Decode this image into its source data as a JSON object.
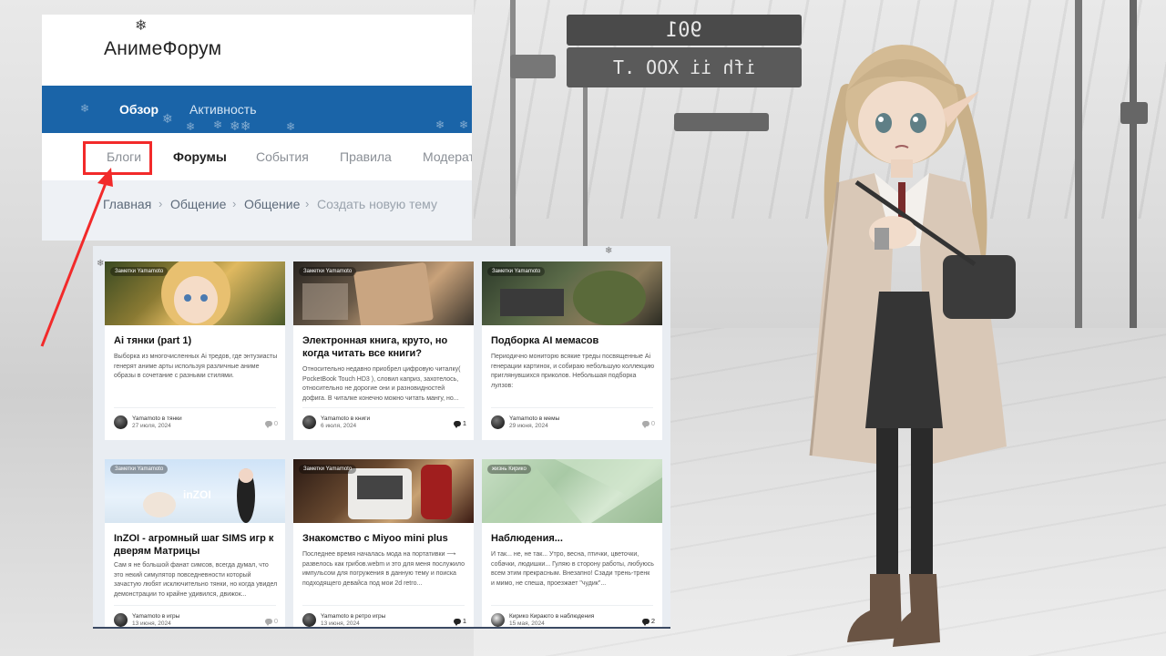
{
  "site": {
    "title": "АнимеФорум"
  },
  "nav": {
    "items": [
      {
        "label": "Обзор",
        "active": true
      },
      {
        "label": "Активность",
        "active": false
      }
    ]
  },
  "subnav": {
    "items": [
      "Блоги",
      "Форумы",
      "События",
      "Правила",
      "Модерат"
    ]
  },
  "breadcrumb": {
    "items": [
      "Главная",
      "Общение",
      "Общение",
      "Создать новую тему"
    ]
  },
  "background": {
    "sign_top": "901",
    "sign_bottom": "ifh ii XOO .T"
  },
  "colors": {
    "nav": "#1a64a8",
    "highlight": "#f22a2a",
    "panel_bg": "#e9edf2"
  },
  "cards": [
    {
      "category": "Заметки Yamamoto",
      "title": "Ai тянки (part 1)",
      "excerpt": "Выборка из многочисленных Ai тредов, где энтузиасты генерят аниме арты используя различные аниме образы в сочетание с разными стилями.",
      "author": "Yamamoto в тянки",
      "date": "27 июля, 2024",
      "comments": "0"
    },
    {
      "category": "Заметки Yamamoto",
      "title": "Электронная книга, круто, но когда читать все книги?",
      "excerpt": "Относительно недавно приобрел цифровую читалку( PocketBook Touch HD3 ), словил каприз, захотелось, относительно не дорогие они и разновидностей дофига. В читалке конечно можно читать мангу, но...",
      "author": "Yamamoto в книги",
      "date": "6 июля, 2024",
      "comments": "1"
    },
    {
      "category": "Заметки Yamamoto",
      "title": "Подборка AI мемасов",
      "excerpt": "Периодично мониторю всякие треды посвященные Ai генерации картинок, и собираю небольшую коллекцию приглянувшихся приколов. Небольшая подборка лулзов:",
      "author": "Yamamoto в мемы",
      "date": "29 июня, 2024",
      "comments": "0"
    },
    {
      "category": "Заметки Yamamoto",
      "title": "InZOI - агромный шаг SIMS игр к дверям Матрицы",
      "excerpt": "Сам я не большой фанат симсов, всегда думал, что это некий симулятор повседневности который зачастую любят исключительно тянки, но когда увидел демонстрации то крайне удивился, движок...",
      "author": "Yamamoto в игры",
      "date": "13 июня, 2024",
      "comments": "0"
    },
    {
      "category": "Заметки Yamamoto",
      "title": "Знакомство с Miyoo mini plus",
      "excerpt": "Последнее время началась мода на портативки ⟶ развелось как грибов.webm и это для меня послужило импульсом для погружения в данную тему и поиска подходящего девайса под мои 2d retro...",
      "author": "Yamamoto в ретро игры",
      "date": "13 июня, 2024",
      "comments": "1"
    },
    {
      "category": "жизнь Кирико",
      "title": "Наблюдения...",
      "excerpt": "И так... не, не так... Утро, весна, птички, цветочки, собачки, людишки... Гуляю в сторону работы, любуюсь всем этим прекрасным. Внезапно! Сзади трень-тренк и мимо, не спеша, проезжает \"чудик\"...",
      "author": "Кирико Кираюто в наблюдения",
      "date": "15 мая, 2024",
      "comments": "2"
    }
  ]
}
